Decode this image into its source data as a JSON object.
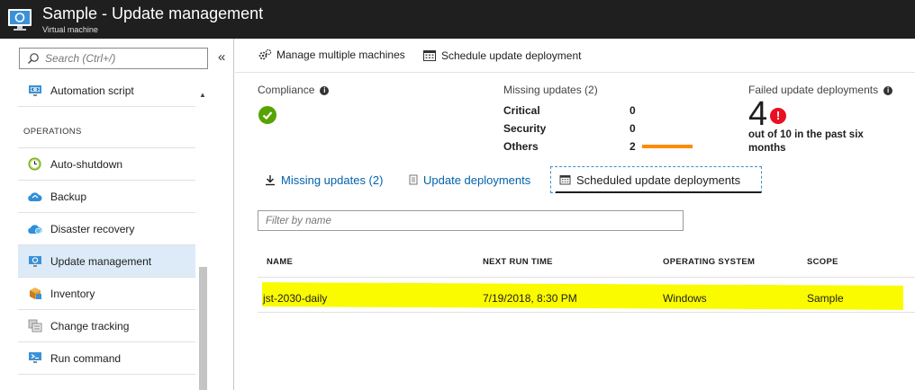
{
  "header": {
    "title": "Sample - Update management",
    "subtitle": "Virtual machine",
    "icon": "virtual-machine-icon"
  },
  "sidebar": {
    "search_placeholder": "Search (Ctrl+/)",
    "collapse_label": "«",
    "top_item": {
      "label": "Automation script",
      "icon": "automation-script-icon"
    },
    "section": "OPERATIONS",
    "items": [
      {
        "label": "Auto-shutdown",
        "icon": "clock-icon"
      },
      {
        "label": "Backup",
        "icon": "cloud-backup-icon"
      },
      {
        "label": "Disaster recovery",
        "icon": "cloud-recovery-icon"
      },
      {
        "label": "Update management",
        "icon": "update-management-icon",
        "active": true
      },
      {
        "label": "Inventory",
        "icon": "inventory-box-icon"
      },
      {
        "label": "Change tracking",
        "icon": "change-tracking-icon"
      },
      {
        "label": "Run command",
        "icon": "run-command-icon"
      }
    ]
  },
  "toolbar": {
    "manage_label": "Manage multiple machines",
    "schedule_label": "Schedule update deployment"
  },
  "summary": {
    "compliance_label": "Compliance",
    "compliance_status": "compliant",
    "missing_label": "Missing updates (2)",
    "missing": [
      {
        "label": "Critical",
        "value": "0"
      },
      {
        "label": "Security",
        "value": "0"
      },
      {
        "label": "Others",
        "value": "2"
      }
    ],
    "failed_label": "Failed update deployments",
    "failed_count": "4",
    "failed_desc": "out of 10 in the past six months"
  },
  "tabs": [
    {
      "label": "Missing updates (2)",
      "icon": "download-icon"
    },
    {
      "label": "Update deployments",
      "icon": "document-icon"
    },
    {
      "label": "Scheduled update deployments",
      "icon": "calendar-icon",
      "active": true
    }
  ],
  "filter": {
    "placeholder": "Filter by name"
  },
  "table": {
    "columns": [
      "NAME",
      "NEXT RUN TIME",
      "OPERATING SYSTEM",
      "SCOPE"
    ],
    "rows": [
      {
        "name": "jst-2030-daily",
        "next_run": "7/19/2018, 8:30 PM",
        "os": "Windows",
        "scope": "Sample"
      }
    ],
    "highlight_color": "#fbfb00"
  },
  "colors": {
    "accent": "#0062ad",
    "success": "#57a300",
    "error": "#e81123",
    "others_bar": "#ff8c00"
  }
}
